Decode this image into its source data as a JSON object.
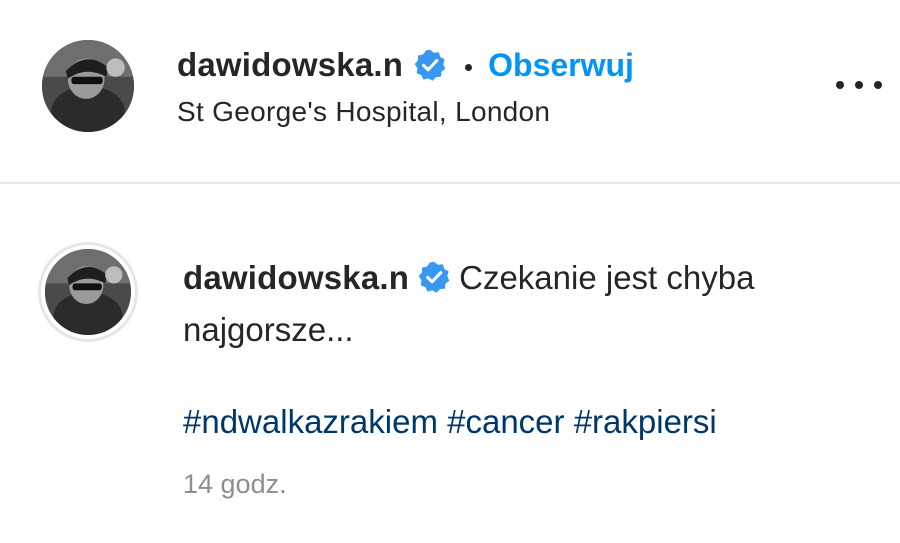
{
  "post_header": {
    "username": "dawidowska.n",
    "verified_icon": "verified-badge-icon",
    "separator": "•",
    "follow_label": "Obserwuj",
    "location": "St George's Hospital, London",
    "more_icon": "more-options-icon"
  },
  "caption": {
    "username": "dawidowska.n",
    "text": "Czekanie jest chyba najgorsze...",
    "hashtags": [
      "#ndwalkazrakiem",
      "#cancer",
      "#rakpiersi"
    ],
    "time": "14 godz."
  },
  "colors": {
    "link_blue": "#0095f6",
    "hashtag_blue": "#00376b",
    "verified_blue": "#3897f0",
    "muted_text": "#8e8e8e"
  }
}
